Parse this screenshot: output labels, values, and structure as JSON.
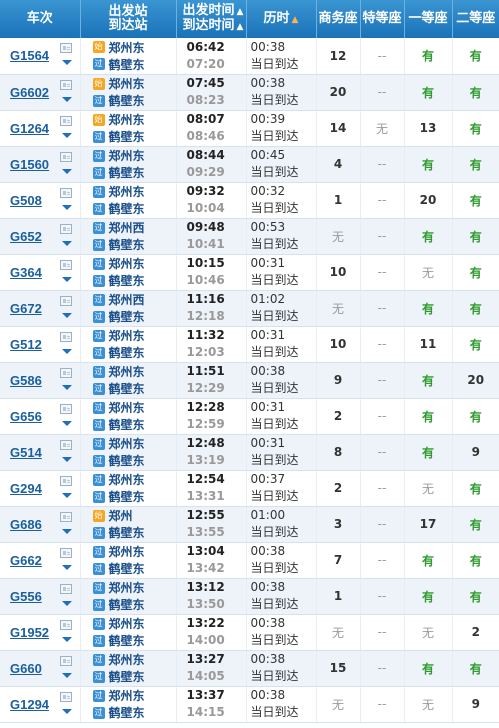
{
  "header": {
    "train": "车次",
    "station_dep": "出发站",
    "station_arr": "到达站",
    "time_dep": "出发时间",
    "time_arr": "到达时间",
    "duration": "历时",
    "business": "商务座",
    "premium": "特等座",
    "first": "一等座",
    "second": "二等座",
    "sort_arrow": "▲"
  },
  "badges": {
    "start": "始",
    "pass": "过"
  },
  "colors": {
    "header_bg": "#1a72b8",
    "train_link": "#1a5fa0",
    "available": "#2e9b2e",
    "row_alt": "#eef3f9"
  },
  "rows": [
    {
      "train": "G1564",
      "dep_badge": "start",
      "dep": "郑州东",
      "arr": "鹤壁东",
      "dep_time": "06:42",
      "arr_time": "07:20",
      "duration": "00:38",
      "arrive_day": "当日到达",
      "business": "12",
      "premium": "--",
      "first": "有",
      "second": "有"
    },
    {
      "train": "G6602",
      "dep_badge": "start",
      "dep": "郑州东",
      "arr": "鹤壁东",
      "dep_time": "07:45",
      "arr_time": "08:23",
      "duration": "00:38",
      "arrive_day": "当日到达",
      "business": "20",
      "premium": "--",
      "first": "有",
      "second": "有"
    },
    {
      "train": "G1264",
      "dep_badge": "start",
      "dep": "郑州东",
      "arr": "鹤壁东",
      "dep_time": "08:07",
      "arr_time": "08:46",
      "duration": "00:39",
      "arrive_day": "当日到达",
      "business": "14",
      "premium": "无",
      "first": "13",
      "second": "有"
    },
    {
      "train": "G1560",
      "dep_badge": "pass",
      "dep": "郑州东",
      "arr": "鹤壁东",
      "dep_time": "08:44",
      "arr_time": "09:29",
      "duration": "00:45",
      "arrive_day": "当日到达",
      "business": "4",
      "premium": "--",
      "first": "有",
      "second": "有"
    },
    {
      "train": "G508",
      "dep_badge": "pass",
      "dep": "郑州东",
      "arr": "鹤壁东",
      "dep_time": "09:32",
      "arr_time": "10:04",
      "duration": "00:32",
      "arrive_day": "当日到达",
      "business": "1",
      "premium": "--",
      "first": "20",
      "second": "有"
    },
    {
      "train": "G652",
      "dep_badge": "pass",
      "dep": "郑州西",
      "arr": "鹤壁东",
      "dep_time": "09:48",
      "arr_time": "10:41",
      "duration": "00:53",
      "arrive_day": "当日到达",
      "business": "无",
      "premium": "--",
      "first": "有",
      "second": "有"
    },
    {
      "train": "G364",
      "dep_badge": "pass",
      "dep": "郑州东",
      "arr": "鹤壁东",
      "dep_time": "10:15",
      "arr_time": "10:46",
      "duration": "00:31",
      "arrive_day": "当日到达",
      "business": "10",
      "premium": "--",
      "first": "无",
      "second": "有"
    },
    {
      "train": "G672",
      "dep_badge": "pass",
      "dep": "郑州西",
      "arr": "鹤壁东",
      "dep_time": "11:16",
      "arr_time": "12:18",
      "duration": "01:02",
      "arrive_day": "当日到达",
      "business": "无",
      "premium": "--",
      "first": "有",
      "second": "有"
    },
    {
      "train": "G512",
      "dep_badge": "pass",
      "dep": "郑州东",
      "arr": "鹤壁东",
      "dep_time": "11:32",
      "arr_time": "12:03",
      "duration": "00:31",
      "arrive_day": "当日到达",
      "business": "10",
      "premium": "--",
      "first": "11",
      "second": "有"
    },
    {
      "train": "G586",
      "dep_badge": "pass",
      "dep": "郑州东",
      "arr": "鹤壁东",
      "dep_time": "11:51",
      "arr_time": "12:29",
      "duration": "00:38",
      "arrive_day": "当日到达",
      "business": "9",
      "premium": "--",
      "first": "有",
      "second": "20"
    },
    {
      "train": "G656",
      "dep_badge": "pass",
      "dep": "郑州东",
      "arr": "鹤壁东",
      "dep_time": "12:28",
      "arr_time": "12:59",
      "duration": "00:31",
      "arrive_day": "当日到达",
      "business": "2",
      "premium": "--",
      "first": "有",
      "second": "有"
    },
    {
      "train": "G514",
      "dep_badge": "pass",
      "dep": "郑州东",
      "arr": "鹤壁东",
      "dep_time": "12:48",
      "arr_time": "13:19",
      "duration": "00:31",
      "arrive_day": "当日到达",
      "business": "8",
      "premium": "--",
      "first": "有",
      "second": "9"
    },
    {
      "train": "G294",
      "dep_badge": "pass",
      "dep": "郑州东",
      "arr": "鹤壁东",
      "dep_time": "12:54",
      "arr_time": "13:31",
      "duration": "00:37",
      "arrive_day": "当日到达",
      "business": "2",
      "premium": "--",
      "first": "无",
      "second": "有"
    },
    {
      "train": "G686",
      "dep_badge": "start",
      "dep": "郑州",
      "arr": "鹤壁东",
      "dep_time": "12:55",
      "arr_time": "13:55",
      "duration": "01:00",
      "arrive_day": "当日到达",
      "business": "3",
      "premium": "--",
      "first": "17",
      "second": "有"
    },
    {
      "train": "G662",
      "dep_badge": "pass",
      "dep": "郑州东",
      "arr": "鹤壁东",
      "dep_time": "13:04",
      "arr_time": "13:42",
      "duration": "00:38",
      "arrive_day": "当日到达",
      "business": "7",
      "premium": "--",
      "first": "有",
      "second": "有"
    },
    {
      "train": "G556",
      "dep_badge": "pass",
      "dep": "郑州东",
      "arr": "鹤壁东",
      "dep_time": "13:12",
      "arr_time": "13:50",
      "duration": "00:38",
      "arrive_day": "当日到达",
      "business": "1",
      "premium": "--",
      "first": "有",
      "second": "有"
    },
    {
      "train": "G1952",
      "dep_badge": "pass",
      "dep": "郑州东",
      "arr": "鹤壁东",
      "dep_time": "13:22",
      "arr_time": "14:00",
      "duration": "00:38",
      "arrive_day": "当日到达",
      "business": "无",
      "premium": "--",
      "first": "无",
      "second": "2"
    },
    {
      "train": "G660",
      "dep_badge": "pass",
      "dep": "郑州东",
      "arr": "鹤壁东",
      "dep_time": "13:27",
      "arr_time": "14:05",
      "duration": "00:38",
      "arrive_day": "当日到达",
      "business": "15",
      "premium": "--",
      "first": "有",
      "second": "有"
    },
    {
      "train": "G1294",
      "dep_badge": "pass",
      "dep": "郑州东",
      "arr": "鹤壁东",
      "dep_time": "13:37",
      "arr_time": "14:15",
      "duration": "00:38",
      "arrive_day": "当日到达",
      "business": "无",
      "premium": "--",
      "first": "无",
      "second": "9"
    }
  ]
}
